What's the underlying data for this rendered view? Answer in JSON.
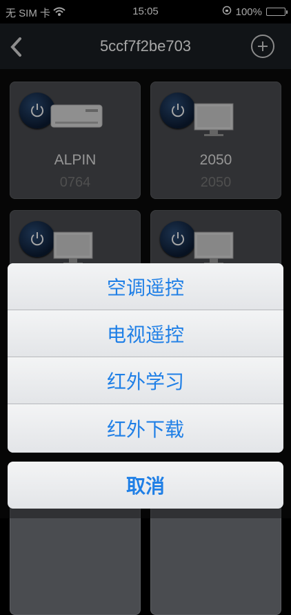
{
  "status": {
    "carrier": "无 SIM 卡",
    "time": "15:05",
    "battery": "100%"
  },
  "nav": {
    "title": "5ccf7f2be703"
  },
  "devices": [
    {
      "name": "ALPIN",
      "code": "0764",
      "type": "air-conditioner"
    },
    {
      "name": "2050",
      "code": "2050",
      "type": "tv"
    },
    {
      "name": "",
      "code": "",
      "type": "tv"
    },
    {
      "name": "",
      "code": "",
      "type": "tv"
    }
  ],
  "action_sheet": {
    "items": [
      "空调遥控",
      "电视遥控",
      "红外学习",
      "红外下载"
    ],
    "cancel": "取消"
  },
  "colors": {
    "accent": "#1f7fe6",
    "battery": "#35d04a"
  }
}
